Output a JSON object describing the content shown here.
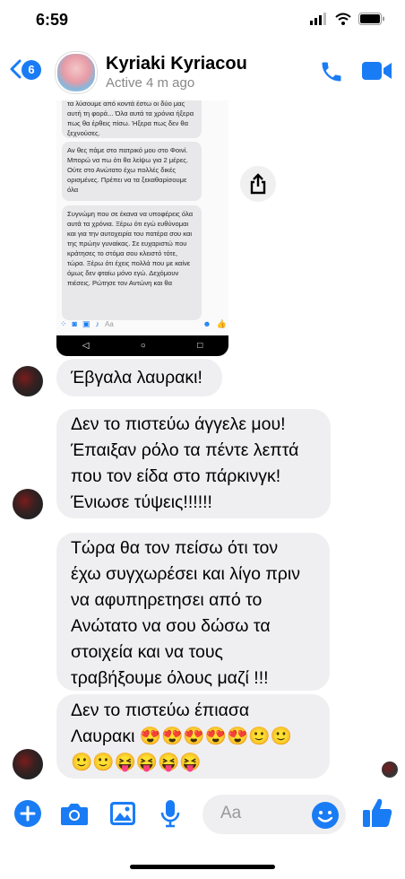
{
  "status_bar": {
    "time": "6:59"
  },
  "header": {
    "unread_count": "6",
    "contact_name": "Kyriaki Kyriacou",
    "contact_status": "Active 4 m ago"
  },
  "screenshot": {
    "bubbles": [
      "τα λύσουμε από κοντά έστω οι δύο μας αυτή τη φορά... Όλα αυτά τα χρόνια ήξερα πως θα έρθεις πίσω. Ήξερα πως δεν θα ξεχνούσες.",
      "Αν θες πάμε στο πατρικό μου στο Φοινί. Μπορώ να πω ότι θα λείψω για 2 μέρες. Ούτε στο Ανώτατο έχω πολλές δικές ορισμένες. Πρέπει να τα ξεκαθαρίσουμε όλα",
      "Συγνώμη που σε έκανα να υποφέρεις όλα αυτά τα χρόνια. Ξέρω ότι εγώ ευθύνομαι και για την αυτοχειρία του πατέρα σου και της πρώην γυναίκας. Σε ευχαριστώ που κράτησες το στόμα σου κλειστό τότε, τώρα. Ξέρω ότι έχεις πολλά που με καίνε όμως δεν φταίω μόνο εγώ. Δεχόμουν πιέσεις. Ρώτησε τον Αντώνη και θα"
    ],
    "toolbar_placeholder": "Aa",
    "nav": [
      "◁",
      "○",
      "□"
    ]
  },
  "messages": [
    {
      "text": "Έβγαλα λαυρακι!"
    },
    {
      "lines": [
        "Δεν το πιστεύω άγγελε μου!",
        "Έπαιξαν ρόλο τα πέντε λεπτά",
        "που τον είδα στο πάρκινγκ!",
        "Ένιωσε τύψεις!!!!!!"
      ]
    },
    {
      "lines": [
        "Τώρα θα τον πείσω ότι τον",
        "έχω συγχωρέσει και λίγο πριν",
        "να αφυπηρετησει από το",
        "Ανώτατο να σου δώσω τα",
        "στοιχεία και να τους",
        "τραβήξουμε όλους μαζί !!!"
      ]
    },
    {
      "lines": [
        "Δεν το πιστεύω έπιασα",
        "Λαυρακι 😍😍😍😍😍🙂🙂",
        "🙂🙂😝😝😝😝"
      ]
    }
  ],
  "composer": {
    "placeholder": "Aa"
  },
  "colors": {
    "accent": "#1a7cf5",
    "bubble": "#efeff1"
  }
}
